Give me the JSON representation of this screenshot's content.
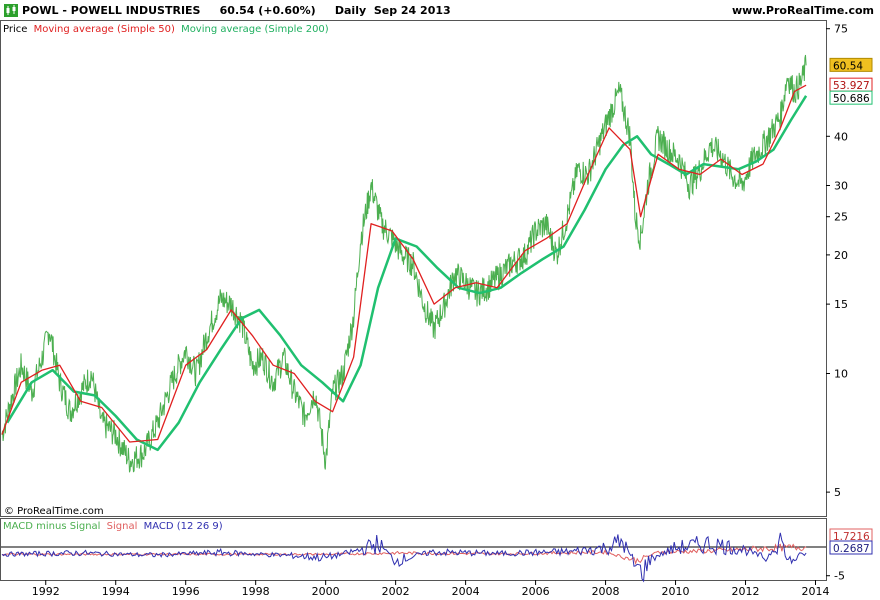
{
  "header": {
    "symbol": "POWL - POWELL INDUSTRIES",
    "last": "60.54",
    "change": "(+0.60%)",
    "period": "Daily",
    "date": "Sep 24 2013",
    "site": "www.ProRealTime.com"
  },
  "legend": {
    "price": "Price",
    "ma50": "Moving average (Simple 50)",
    "ma200": "Moving average (Simple 200)"
  },
  "copyright": "© ProRealTime.com",
  "macd_legend": {
    "hist": "MACD minus Signal",
    "signal": "Signal",
    "macd": "MACD (12 26 9)"
  },
  "colors": {
    "price": "#4caf50",
    "ma50": "#e02020",
    "ma200": "#20c070",
    "macd": "#3030b0",
    "signal": "#e06060",
    "last_tag": "#f0c020"
  },
  "chart_data": [
    {
      "type": "line",
      "scale": "log",
      "ylim": [
        4.4,
        78
      ],
      "y_ticks": [
        5,
        10,
        15,
        20,
        25,
        30,
        40,
        75
      ],
      "x_ticks": [
        "1992",
        "1994",
        "1996",
        "1998",
        "2000",
        "2002",
        "2004",
        "2006",
        "2008",
        "2010",
        "2012",
        "2014"
      ],
      "x_range": [
        1990.75,
        2014.3
      ],
      "value_tags": [
        {
          "label": "60.54",
          "value": 60.54,
          "series": "Price"
        },
        {
          "label": "53.927",
          "value": 53.927,
          "series": "Moving average (Simple 50)"
        },
        {
          "label": "50.686",
          "value": 50.686,
          "series": "Moving average (Simple 200)"
        }
      ],
      "series": [
        {
          "name": "Price",
          "x": [
            1990.75,
            1991.0,
            1991.3,
            1991.6,
            1991.9,
            1992.1,
            1992.4,
            1992.7,
            1993.0,
            1993.3,
            1993.6,
            1994.0,
            1994.4,
            1994.8,
            1995.2,
            1995.6,
            1996.0,
            1996.3,
            1996.6,
            1997.0,
            1997.3,
            1997.6,
            1997.9,
            1998.2,
            1998.5,
            1998.8,
            1999.1,
            1999.4,
            1999.7,
            2000.0,
            2000.2,
            2000.5,
            2000.8,
            2001.0,
            2001.3,
            2001.6,
            2001.9,
            2002.2,
            2002.5,
            2002.8,
            2003.1,
            2003.4,
            2003.7,
            2004.0,
            2004.3,
            2004.6,
            2004.9,
            2005.3,
            2005.7,
            2006.0,
            2006.3,
            2006.6,
            2006.9,
            2007.2,
            2007.5,
            2007.8,
            2008.1,
            2008.4,
            2008.7,
            2008.85,
            2009.0,
            2009.2,
            2009.5,
            2009.8,
            2010.1,
            2010.4,
            2010.7,
            2011.0,
            2011.3,
            2011.6,
            2011.9,
            2012.2,
            2012.5,
            2012.8,
            2013.0,
            2013.2,
            2013.4,
            2013.6,
            2013.73
          ],
          "y": [
            7.0,
            8.5,
            10.5,
            9.0,
            11.0,
            13.0,
            9.5,
            8.0,
            9.0,
            10.0,
            7.5,
            7.0,
            6.0,
            6.3,
            7.5,
            9.5,
            11.5,
            10.0,
            12.5,
            15.5,
            15.0,
            13.5,
            10.5,
            11.0,
            9.5,
            11.0,
            9.0,
            7.8,
            9.0,
            6.0,
            9.0,
            10.0,
            14.0,
            22.0,
            30.0,
            24.0,
            22.0,
            20.0,
            19.0,
            15.0,
            13.0,
            15.0,
            18.0,
            17.0,
            16.0,
            16.5,
            17.5,
            19.0,
            20.0,
            23.0,
            24.0,
            20.0,
            25.0,
            33.0,
            32.0,
            38.0,
            45.0,
            52.0,
            40.0,
            25.0,
            22.0,
            30.0,
            40.0,
            37.0,
            35.0,
            30.0,
            33.0,
            38.0,
            36.0,
            32.0,
            30.0,
            35.0,
            38.0,
            42.0,
            45.0,
            57.0,
            52.0,
            55.0,
            60.54
          ]
        },
        {
          "name": "Moving average (Simple 50)",
          "x": [
            1990.75,
            1991.3,
            1991.9,
            1992.4,
            1993.0,
            1993.6,
            1994.4,
            1995.2,
            1996.0,
            1996.6,
            1997.3,
            1997.9,
            1998.5,
            1999.1,
            1999.7,
            2000.2,
            2000.8,
            2001.3,
            2001.9,
            2002.5,
            2003.1,
            2003.7,
            2004.3,
            2004.9,
            2005.7,
            2006.3,
            2006.9,
            2007.5,
            2008.1,
            2008.7,
            2009.0,
            2009.5,
            2010.1,
            2010.7,
            2011.3,
            2011.9,
            2012.5,
            2013.0,
            2013.4,
            2013.73
          ],
          "y": [
            7.0,
            9.5,
            10.2,
            10.5,
            8.5,
            8.2,
            6.7,
            6.8,
            10.5,
            11.5,
            14.5,
            12.5,
            10.5,
            10.0,
            8.5,
            8.0,
            11.0,
            24.0,
            23.0,
            19.5,
            15.0,
            16.5,
            17.0,
            16.5,
            20.5,
            22.0,
            24.0,
            32.0,
            42.0,
            37.0,
            25.0,
            36.0,
            33.0,
            32.0,
            35.0,
            32.0,
            34.0,
            42.0,
            52.0,
            53.927
          ]
        },
        {
          "name": "Moving average (Simple 200)",
          "x": [
            1990.9,
            1991.6,
            1992.2,
            1992.8,
            1993.4,
            1994.0,
            1994.6,
            1995.2,
            1995.8,
            1996.4,
            1997.0,
            1997.6,
            1998.1,
            1998.7,
            1999.3,
            1999.9,
            2000.5,
            2001.0,
            2001.5,
            2002.0,
            2002.6,
            2003.2,
            2003.8,
            2004.4,
            2005.0,
            2005.6,
            2006.2,
            2006.8,
            2007.4,
            2008.0,
            2008.5,
            2008.9,
            2009.3,
            2009.8,
            2010.3,
            2010.8,
            2011.3,
            2011.8,
            2012.3,
            2012.8,
            2013.3,
            2013.73
          ],
          "y": [
            7.5,
            9.5,
            10.2,
            9.0,
            8.8,
            7.8,
            6.8,
            6.4,
            7.5,
            9.5,
            11.5,
            13.8,
            14.5,
            12.5,
            10.5,
            9.5,
            8.5,
            10.5,
            16.5,
            22.0,
            21.0,
            18.5,
            16.5,
            16.0,
            16.5,
            18.0,
            19.5,
            21.0,
            26.0,
            33.0,
            38.0,
            40.0,
            36.0,
            34.0,
            32.0,
            34.0,
            33.5,
            33.0,
            34.5,
            37.0,
            44.0,
            50.686
          ]
        }
      ]
    },
    {
      "type": "line",
      "ylim": [
        -6,
        8
      ],
      "y_ticks": [
        -5
      ],
      "value_tags": [
        {
          "label": "1.7216",
          "value": 1.7216,
          "series": "Signal"
        },
        {
          "label": "0.2687",
          "value": 0.2687,
          "series": "MACD (12 26 9)"
        }
      ],
      "series": [
        {
          "name": "MACD (12 26 9)",
          "x": [
            1990.75,
            1993.0,
            1995.0,
            1997.0,
            1999.0,
            2000.0,
            2001.0,
            2001.5,
            2002.0,
            2003.0,
            2005.0,
            2007.0,
            2008.0,
            2008.5,
            2008.8,
            2009.0,
            2009.3,
            2010.0,
            2011.0,
            2012.0,
            2012.6,
            2013.0,
            2013.2,
            2013.4,
            2013.73
          ],
          "y": [
            0,
            0.3,
            -0.2,
            0.4,
            -0.3,
            -0.8,
            1.0,
            2.5,
            -1.5,
            0.5,
            0.2,
            0.6,
            1.5,
            3.0,
            -2.0,
            -4.5,
            -1.0,
            1.5,
            2.5,
            1.0,
            -1.0,
            4.0,
            -2.0,
            -1.0,
            0.2687
          ]
        },
        {
          "name": "Signal",
          "x": [
            1990.75,
            1995.0,
            2000.0,
            2002.0,
            2005.0,
            2008.0,
            2008.9,
            2009.5,
            2011.0,
            2013.0,
            2013.73
          ],
          "y": [
            0,
            0,
            0,
            0.3,
            0.1,
            0.5,
            -1.5,
            0.5,
            0.8,
            1.5,
            1.7216
          ]
        }
      ]
    }
  ]
}
